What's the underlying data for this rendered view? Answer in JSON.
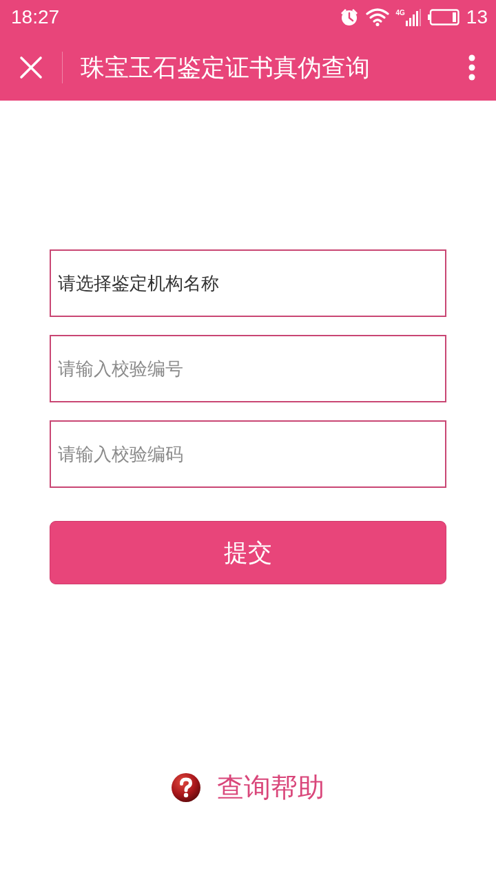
{
  "status_bar": {
    "time": "18:27",
    "network": "4G",
    "battery": "13"
  },
  "header": {
    "title": "珠宝玉石鉴定证书真伪查询"
  },
  "form": {
    "fields": [
      {
        "kind": "select",
        "value": "请选择鉴定机构名称"
      },
      {
        "kind": "input",
        "placeholder": "请输入校验编号"
      },
      {
        "kind": "input",
        "placeholder": "请输入校验编码"
      }
    ],
    "submit": "提交"
  },
  "help_link": "查询帮助"
}
